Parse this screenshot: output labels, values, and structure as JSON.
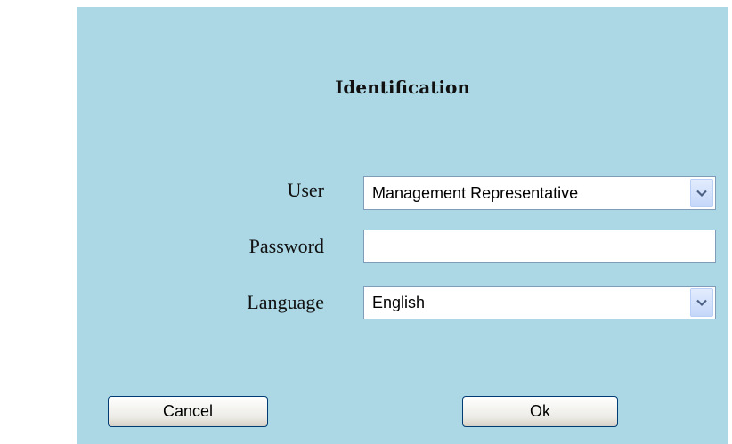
{
  "dialog": {
    "title": "Identification"
  },
  "form": {
    "user": {
      "label": "User",
      "selected": "Management Representative"
    },
    "password": {
      "label": "Password",
      "value": ""
    },
    "language": {
      "label": "Language",
      "selected": "English"
    }
  },
  "buttons": {
    "cancel_label": "Cancel",
    "ok_label": "Ok"
  },
  "colors": {
    "panel_background": "#acd8e5",
    "field_border": "#7f9db9"
  },
  "icons": {
    "dropdown": "chevron-down-icon"
  }
}
